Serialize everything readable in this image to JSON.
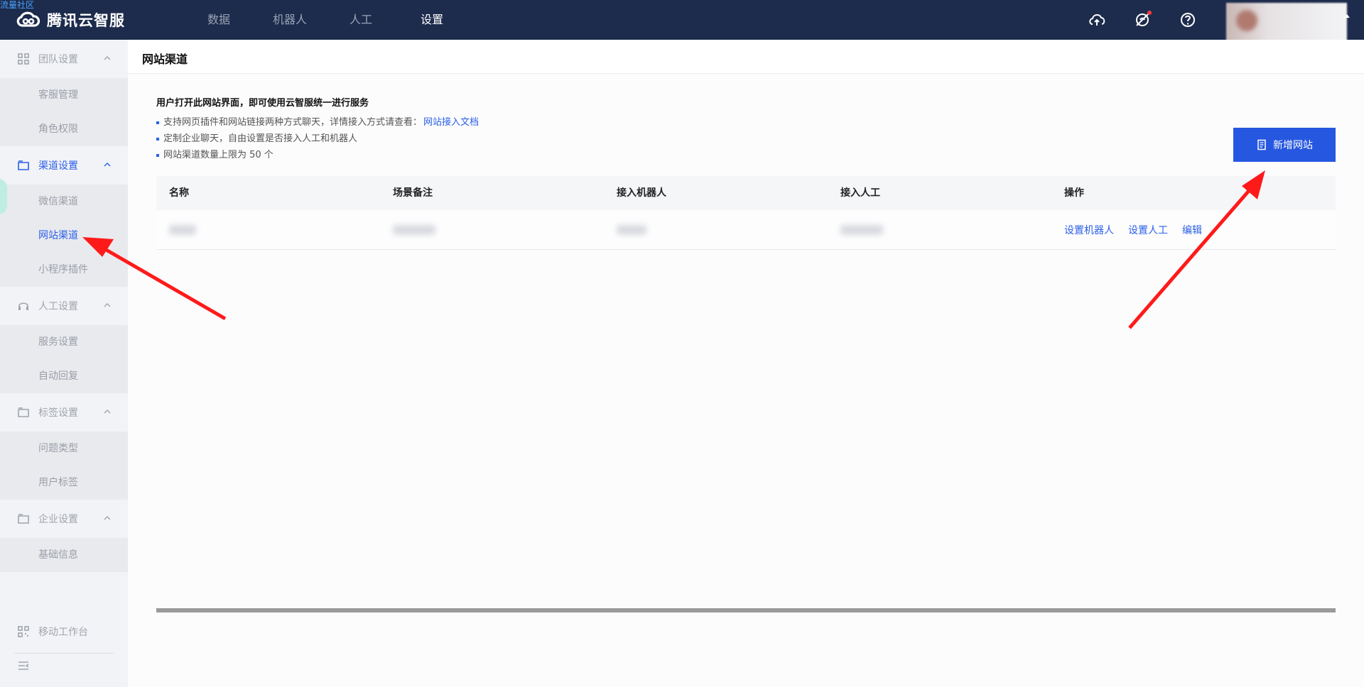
{
  "watermark": "流量社区",
  "brand": {
    "name": "腾讯云智服"
  },
  "topnav": [
    {
      "label": "数据",
      "active": false
    },
    {
      "label": "机器人",
      "active": false
    },
    {
      "label": "人工",
      "active": false
    },
    {
      "label": "设置",
      "active": true
    }
  ],
  "top_icons": [
    "cloud-upload-icon",
    "notification-off-icon",
    "help-icon"
  ],
  "sidebar": {
    "groups": [
      {
        "label": "团队设置",
        "icon": "grid-icon",
        "items": [
          "客服管理",
          "角色权限"
        ]
      },
      {
        "label": "渠道设置",
        "icon": "folder-icon",
        "active": true,
        "items": [
          "微信渠道",
          "网站渠道",
          "小程序插件"
        ],
        "active_item": "网站渠道"
      },
      {
        "label": "人工设置",
        "icon": "headset-icon",
        "items": [
          "服务设置",
          "自动回复"
        ]
      },
      {
        "label": "标签设置",
        "icon": "folder-icon",
        "items": [
          "问题类型",
          "用户标签"
        ]
      },
      {
        "label": "企业设置",
        "icon": "folder-icon",
        "items": [
          "基础信息"
        ]
      }
    ],
    "bottom": {
      "mobile_workbench": "移动工作台"
    }
  },
  "page": {
    "title": "网站渠道",
    "description": {
      "heading": "用户打开此网站界面，即可使用云智服统一进行服务",
      "lines": [
        {
          "text": "支持网页插件和网站链接两种方式聊天，详情接入方式请查看：",
          "link": "网站接入文档"
        },
        {
          "text": "定制企业聊天，自由设置是否接入人工和机器人"
        },
        {
          "text": "网站渠道数量上限为 50 个"
        }
      ]
    },
    "add_button": "新增网站",
    "table": {
      "columns": [
        "名称",
        "场景备注",
        "接入机器人",
        "接入人工",
        "操作"
      ],
      "row_actions": [
        "设置机器人",
        "设置人工",
        "编辑"
      ]
    }
  },
  "colors": {
    "topbar": "#1d2b4c",
    "accent": "#2b5fe8",
    "button": "#2657e0",
    "arrow": "#ff1a1a"
  }
}
